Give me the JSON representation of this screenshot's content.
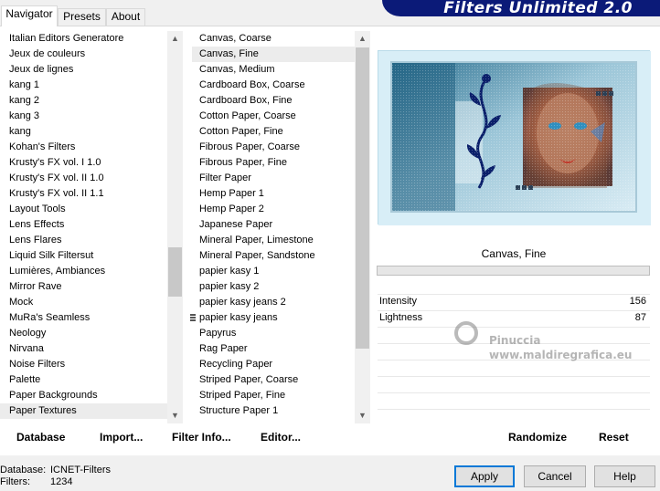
{
  "tabs": [
    "Navigator",
    "Presets",
    "About"
  ],
  "banner": "Filters Unlimited 2.0",
  "categories": [
    "Italian Editors Generatore",
    "Jeux de couleurs",
    "Jeux de lignes",
    "kang 1",
    "kang 2",
    "kang 3",
    "kang",
    "Kohan's Filters",
    "Krusty's FX vol. I 1.0",
    "Krusty's FX vol. II 1.0",
    "Krusty's FX vol. II 1.1",
    "Layout Tools",
    "Lens Effects",
    "Lens Flares",
    "Liquid Silk Filtersut",
    "Lumières, Ambiances",
    "Mirror Rave",
    "Mock",
    "MuRa's Seamless",
    "Neology",
    "Nirvana",
    "Noise Filters",
    "Palette",
    "Paper Backgrounds",
    "Paper Textures"
  ],
  "categories_selected": 24,
  "filters": [
    "Canvas, Coarse",
    "Canvas, Fine",
    "Canvas, Medium",
    "Cardboard Box, Coarse",
    "Cardboard Box, Fine",
    "Cotton Paper, Coarse",
    "Cotton Paper, Fine",
    "Fibrous Paper, Coarse",
    "Fibrous Paper, Fine",
    "Filter Paper",
    "Hemp Paper 1",
    "Hemp Paper 2",
    "Japanese Paper",
    "Mineral Paper, Limestone",
    "Mineral Paper, Sandstone",
    "papier kasy 1",
    "papier kasy 2",
    "papier kasy jeans 2",
    "papier kasy jeans",
    "Papyrus",
    "Rag Paper",
    "Recycling Paper",
    "Striped Paper, Coarse",
    "Striped Paper, Fine",
    "Structure Paper 1"
  ],
  "filters_selected": 1,
  "list_buttons": {
    "database": "Database",
    "import": "Import...",
    "filter_info": "Filter Info...",
    "editor": "Editor..."
  },
  "preview": {
    "filter_name": "Canvas, Fine",
    "params": [
      {
        "label": "Intensity",
        "value": "156"
      },
      {
        "label": "Lightness",
        "value": "87"
      }
    ],
    "randomize": "Randomize",
    "reset": "Reset",
    "watermark_1": "Pinuccia",
    "watermark_2": "www.maldiregrafica.eu"
  },
  "status": {
    "database_label": "Database:",
    "database_value": "ICNET-Filters",
    "filters_label": "Filters:",
    "filters_value": "1234"
  },
  "buttons": {
    "apply": "Apply",
    "cancel": "Cancel",
    "help": "Help"
  }
}
